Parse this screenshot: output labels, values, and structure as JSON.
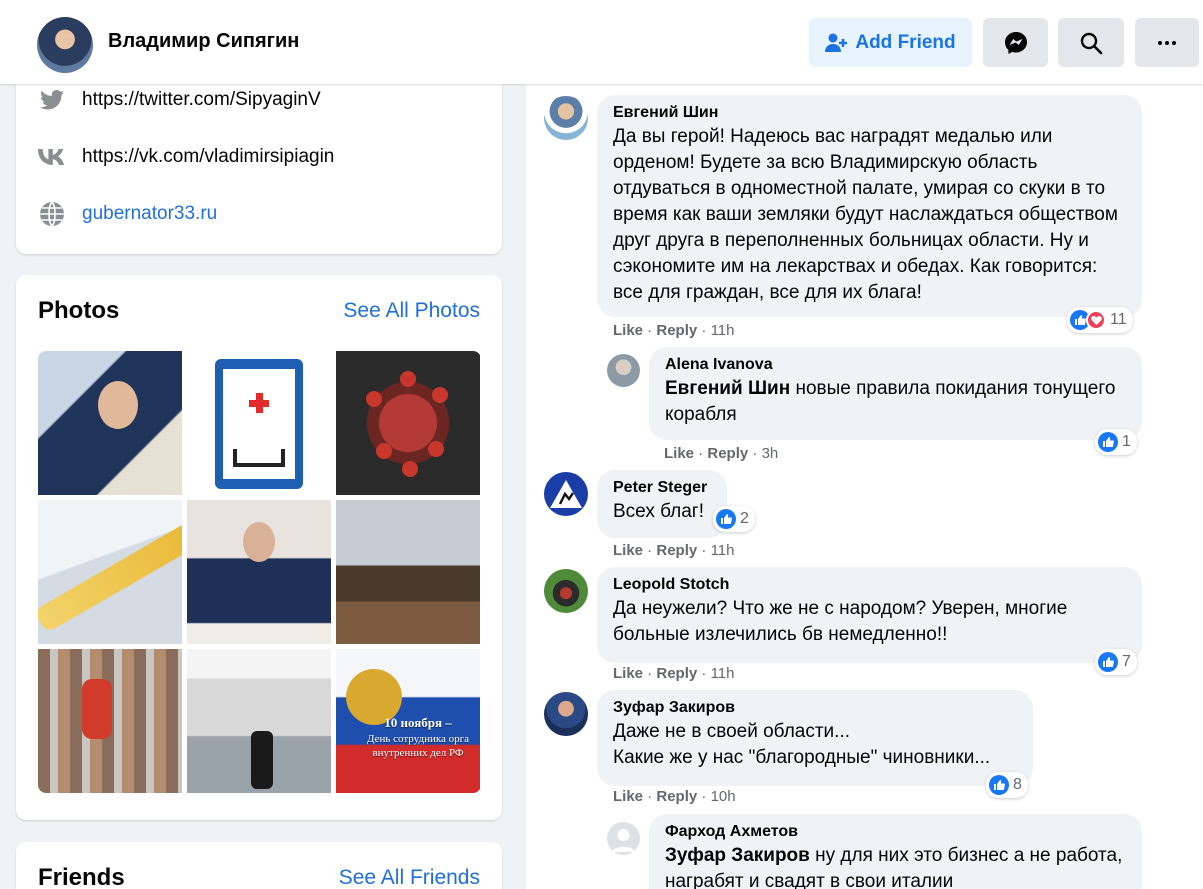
{
  "header": {
    "name": "Владимир Сипягин",
    "add_friend_label": "Add Friend",
    "icons": [
      "messenger-icon",
      "search-icon",
      "more-icon"
    ]
  },
  "intro": {
    "links": [
      {
        "icon": "twitter-icon",
        "text": "https://twitter.com/SipyaginV"
      },
      {
        "icon": "vk-icon",
        "text": "https://vk.com/vladimirsipiagin"
      },
      {
        "icon": "globe-icon",
        "text": "gubernator33.ru"
      }
    ]
  },
  "photos": {
    "title": "Photos",
    "see_all": "See All Photos",
    "banner_line1": "10 ноября –",
    "banner_line2": "День сотрудника орга",
    "banner_line3": "внутренних дел РФ"
  },
  "friends": {
    "title": "Friends",
    "see_all": "See All Friends"
  },
  "colors": {
    "accent": "#216fdb",
    "like": "#1877f2",
    "love": "#f33e58",
    "add_friend_bg": "#e7f3ff"
  },
  "comments": [
    {
      "author": "Евгений Шин",
      "text": "Да вы герой! Надеюсь вас наградят медалью или орденом! Будете за всю Владимирскую область отдуваться в одноместной палате, умирая со скуки в то время как ваши земляки будут наслаждаться обществом друг друга в переполненных больницах области. Ну и сэкономите им на лекарствах и обедах. Как говорится: все для граждан, все для их блага!",
      "reactions": "11",
      "like": "Like",
      "reply": "Reply",
      "time": "11h"
    },
    {
      "author": "Alena Ivanova",
      "mention": "Евгений Шин",
      "text": " новые правила покидания тонущего корабля",
      "reactions": "1",
      "like": "Like",
      "reply": "Reply",
      "time": "3h"
    },
    {
      "author": "Peter Steger",
      "text": "Всех благ!",
      "reactions": "2",
      "like": "Like",
      "reply": "Reply",
      "time": "11h"
    },
    {
      "author": "Leopold Stotch",
      "text": "Да неужели? Что же не с народом? Уверен, многие больные излечились бв немедленно!!",
      "reactions": "7",
      "like": "Like",
      "reply": "Reply",
      "time": "11h"
    },
    {
      "author": "Зуфар Закиров",
      "text1": "Даже не в своей области...",
      "text2": "Какие же у нас \"благородные\" чиновники...",
      "reactions": "8",
      "like": "Like",
      "reply": "Reply",
      "time": "10h"
    },
    {
      "author": "Фарход Ахметов",
      "mention": "Зуфар Закиров",
      "text": " ну для них это бизнес а не работа, награбят и свадят в свои италии"
    }
  ]
}
